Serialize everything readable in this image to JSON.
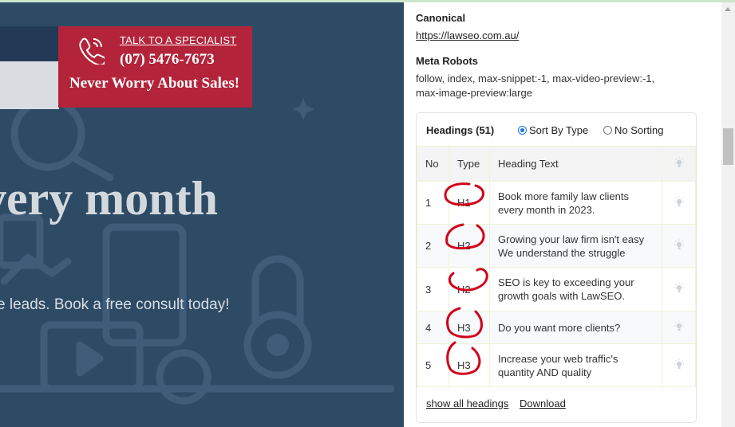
{
  "site": {
    "cta_talk": "TALK TO A SPECIALIST",
    "cta_phone": "(07) 5476-7673",
    "cta_slogan": "Never Worry About Sales!",
    "hero_title": "very month",
    "hero_subtitle": "e leads. Book a free consult today!"
  },
  "panel": {
    "canonical_label": "Canonical",
    "canonical_url": "https://lawseo.com.au/",
    "robots_label": "Meta Robots",
    "robots_line1": "follow, index, max-snippet:-1, max-video-preview:-1,",
    "robots_line2": "max-image-preview:large",
    "headings_title": "Headings (51)",
    "sort_by_type": "Sort By Type",
    "no_sorting": "No Sorting",
    "columns": {
      "no": "No",
      "type": "Type",
      "text": "Heading Text"
    },
    "rows": [
      {
        "no": "1",
        "type": "H1",
        "line1": "Book more family law clients",
        "line2": "every month in 2023."
      },
      {
        "no": "2",
        "type": "H2",
        "line1": "Growing your law firm isn't easy",
        "line2": "We understand the struggle"
      },
      {
        "no": "3",
        "type": "H2",
        "line1": "SEO is key to exceeding your",
        "line2": "growth goals with LawSEO."
      },
      {
        "no": "4",
        "type": "H3",
        "line1": "Do you want more clients?",
        "line2": ""
      },
      {
        "no": "5",
        "type": "H3",
        "line1": "Increase your web traffic's",
        "line2": "quantity AND quality"
      }
    ],
    "show_all": "show all headings",
    "download": "Download"
  },
  "colors": {
    "cta_red": "#b3243a",
    "hero_blue": "#2e4b66",
    "radio_blue": "#1a73e8",
    "annotation_red": "#d0021b"
  }
}
